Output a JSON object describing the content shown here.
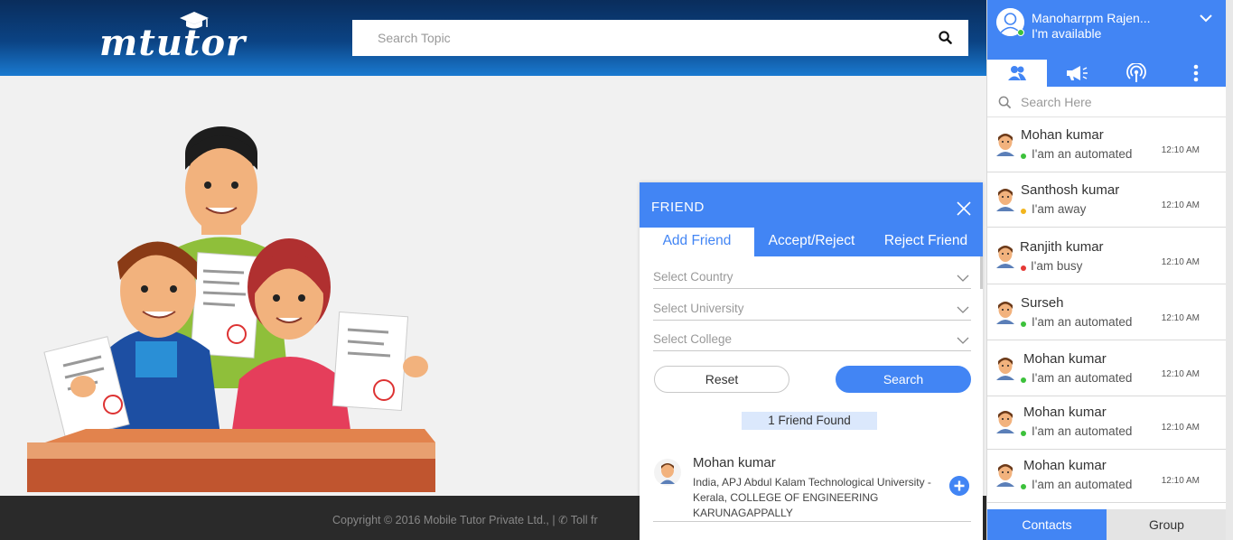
{
  "header": {
    "logo_text": "mtutor",
    "search_placeholder": "Search Topic"
  },
  "footer": {
    "copyright": "Copyright © 2016 Mobile Tutor Private Ltd., | ✆ Toll fr"
  },
  "friend_dialog": {
    "title": "FRIEND",
    "tabs": [
      {
        "label": "Add Friend",
        "active": true
      },
      {
        "label": "Accept/Reject",
        "active": false
      },
      {
        "label": "Reject Friend",
        "active": false
      }
    ],
    "selects": {
      "country": "Select Country",
      "university": "Select University",
      "college": "Select College"
    },
    "reset_label": "Reset",
    "search_label": "Search",
    "found_text": "1 Friend Found",
    "result": {
      "name": "Mohan kumar",
      "detail": "India, APJ Abdul Kalam Technological University - Kerala, COLLEGE OF ENGINEERING KARUNAGAPPALLY"
    }
  },
  "chat_panel": {
    "user_name": "Manoharrpm Rajen...",
    "user_status": "I'm available",
    "search_placeholder": "Search Here",
    "contacts": [
      {
        "name": "Mohan kumar",
        "status": "I'am an automated",
        "time": "12:10 AM",
        "color": "#3cc13b"
      },
      {
        "name": "Santhosh kumar",
        "status": "I'am away",
        "time": "12:10 AM",
        "color": "#f2b51d"
      },
      {
        "name": "Ranjith kumar",
        "status": "I'am busy",
        "time": "12:10 AM",
        "color": "#e53935"
      },
      {
        "name": "Surseh",
        "status": "I'am an automated",
        "time": "12:10 AM",
        "color": "#3cc13b"
      },
      {
        "name": "Mohan kumar",
        "status": "I'am an automated",
        "time": "12:10 AM",
        "color": "#3cc13b"
      },
      {
        "name": "Mohan kumar",
        "status": "I'am an automated",
        "time": "12:10 AM",
        "color": "#3cc13b"
      },
      {
        "name": "Mohan kumar",
        "status": "I'am an automated",
        "time": "12:10 AM",
        "color": "#3cc13b"
      }
    ],
    "footer_tabs": {
      "contacts": "Contacts",
      "group": "Group"
    }
  },
  "colors": {
    "accent": "#4285f4",
    "online": "#3cc13b",
    "away": "#f2b51d",
    "busy": "#e53935"
  }
}
